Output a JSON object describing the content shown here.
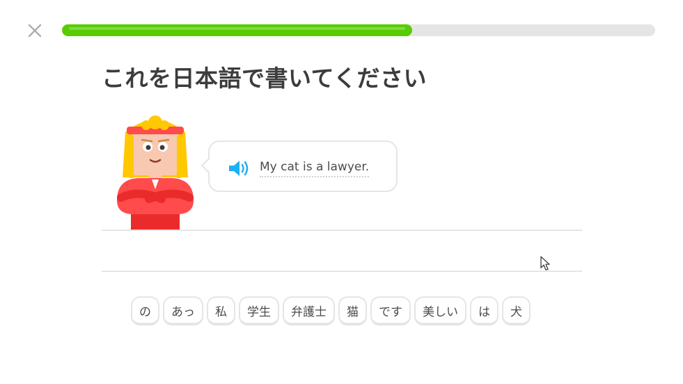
{
  "progress": {
    "value": 0.59,
    "fill_color": "#58cc02",
    "track_color": "#e5e5e5"
  },
  "close": {
    "icon": "close-icon"
  },
  "challenge": {
    "title": "これを日本語で書いてください",
    "prompt": "My cat is a lawyer.",
    "speaker_icon": "speaker-icon",
    "speaker_color": "#1cb0f6"
  },
  "word_bank": {
    "tiles": [
      "の",
      "あっ",
      "私",
      "学生",
      "弁護士",
      "猫",
      "です",
      "美しい",
      "は",
      "犬"
    ]
  }
}
